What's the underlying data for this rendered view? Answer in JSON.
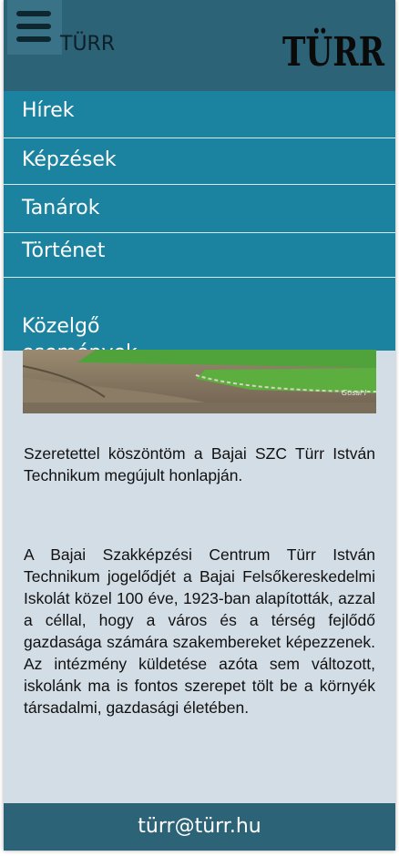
{
  "header": {
    "title": "TÜRR",
    "logo_text": "TÜRR",
    "menu_icon": "hamburger-menu-icon"
  },
  "nav": {
    "items": [
      {
        "label": "Hírek"
      },
      {
        "label": "Képzések"
      },
      {
        "label": "Tanárok"
      },
      {
        "label": "Történet"
      },
      {
        "label": "Közelgő\nesemények"
      }
    ]
  },
  "hero": {
    "watermark": "Gosai I"
  },
  "main": {
    "welcome": "Szeretettel köszöntöm a Bajai SZC Türr István Technikum megújult honlapján.",
    "history": "A Bajai Szakképzési Centrum Türr István Technikum jogelődjét a Bajai Felsőkereskedelmi Iskolát közel 100 éve, 1923-ban alapították, azzal a céllal, hogy a város és a térség fejlődő gazdasága számára szakembereket képezzenek. Az intézmény küldetése azóta sem változott, iskolánk ma is fontos szerepet tölt be a környék társadalmi, gazdasági életében."
  },
  "footer": {
    "email": "türr@türr.hu"
  },
  "colors": {
    "header_bg": "#2d6377",
    "nav_bg": "#1b82a0",
    "page_bg": "#d3dde6"
  }
}
